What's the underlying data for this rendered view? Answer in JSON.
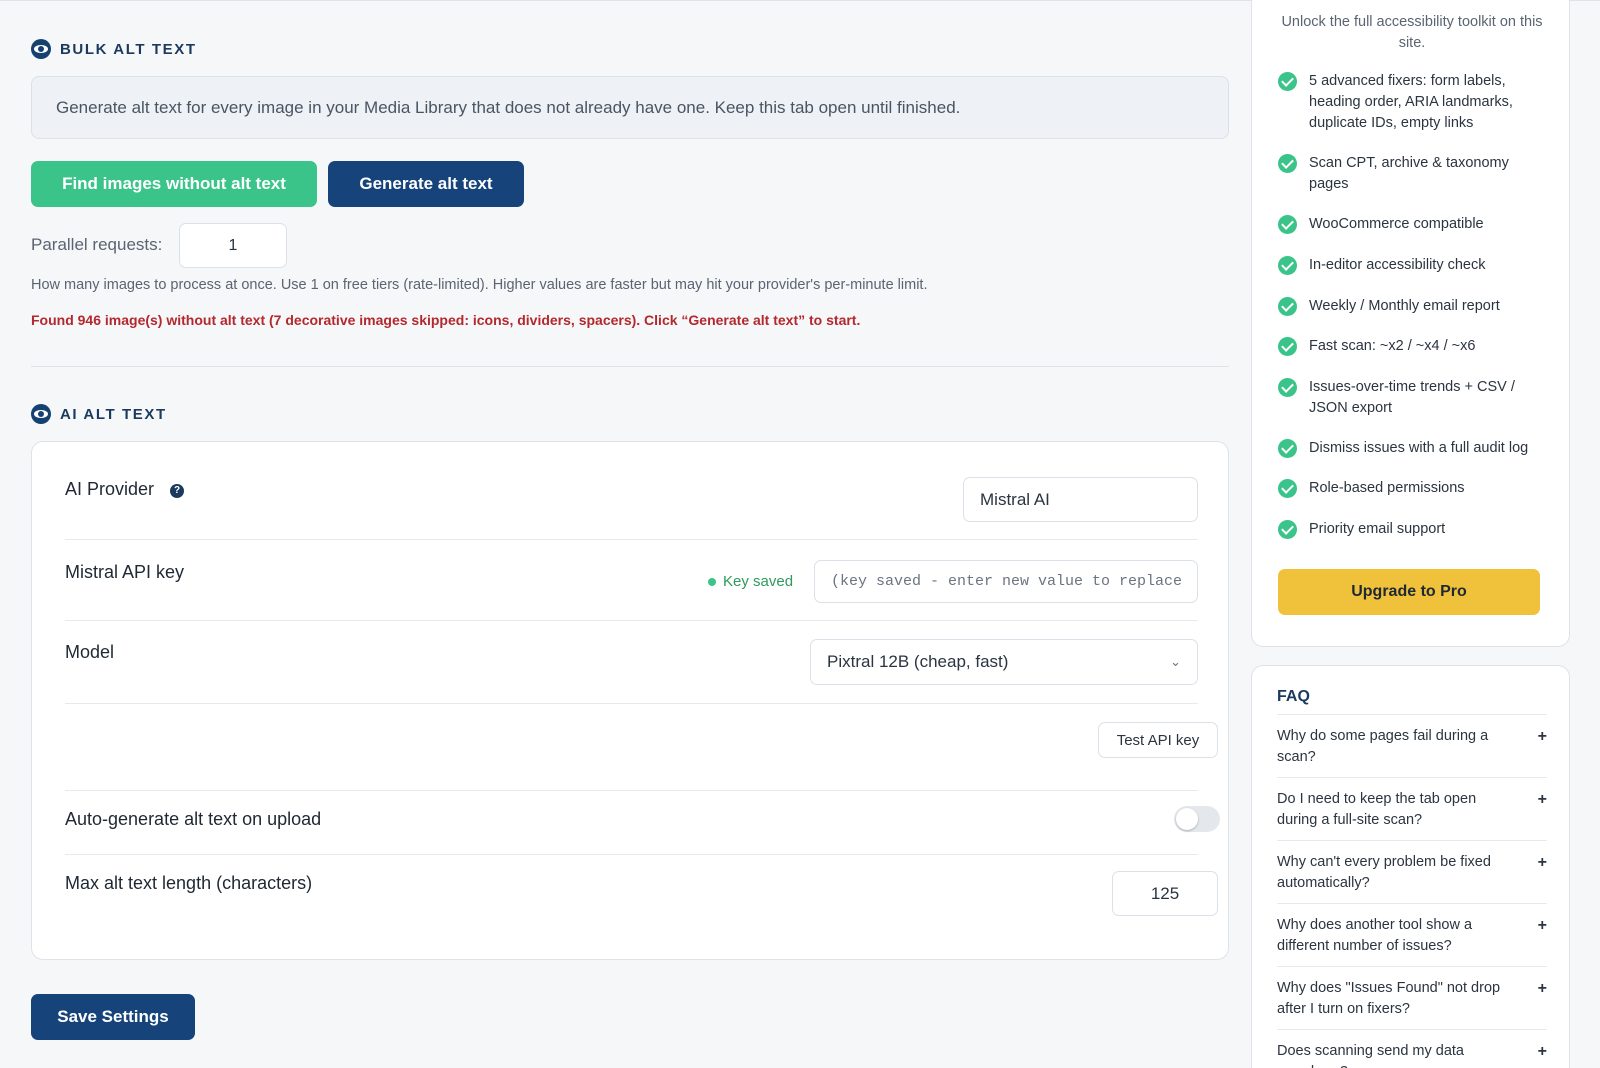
{
  "bulk": {
    "heading": "BULK ALT TEXT",
    "info": "Generate alt text for every image in your Media Library that does not already have one. Keep this tab open until finished.",
    "find_button": "Find images without alt text",
    "generate_button": "Generate alt text",
    "parallel_label": "Parallel requests:",
    "parallel_value": "1",
    "help": "How many images to process at once. Use 1 on free tiers (rate-limited). Higher values are faster but may hit your provider's per-minute limit.",
    "found": "Found 946 image(s) without alt text (7 decorative images skipped: icons, dividers, spacers). Click “Generate alt text” to start."
  },
  "ai": {
    "heading": "AI ALT TEXT",
    "provider_label": "AI Provider",
    "help_icon": "?",
    "provider_value": "Mistral AI",
    "key_label": "Mistral API key",
    "key_status": "Key saved",
    "key_placeholder": "(key saved - enter new value to replace)",
    "model_label": "Model",
    "model_value": "Pixtral 12B (cheap, fast)",
    "test_button": "Test API key",
    "auto_label": "Auto-generate alt text on upload",
    "auto_enabled": false,
    "max_label": "Max alt text length (characters)",
    "max_value": "125",
    "save_button": "Save Settings"
  },
  "pro": {
    "intro": "Unlock the full accessibility toolkit on this site.",
    "features": [
      "5 advanced fixers: form labels, heading order, ARIA landmarks, duplicate IDs, empty links",
      "Scan CPT, archive & taxonomy pages",
      "WooCommerce compatible",
      "In-editor accessibility check",
      "Weekly / Monthly email report",
      "Fast scan: ~x2 / ~x4 / ~x6",
      "Issues-over-time trends + CSV / JSON export",
      "Dismiss issues with a full audit log",
      "Role-based permissions",
      "Priority email support"
    ],
    "upgrade_button": "Upgrade to Pro"
  },
  "faq": {
    "title": "FAQ",
    "items": [
      "Why do some pages fail during a scan?",
      "Do I need to keep the tab open during a full-site scan?",
      "Why can't every problem be fixed automatically?",
      "Why does another tool show a different number of issues?",
      "Why does \"Issues Found\" not drop after I turn on fixers?",
      "Does scanning send my data anywhere?"
    ]
  },
  "colors": {
    "accent_navy": "#16437a",
    "accent_green": "#3bc48a",
    "upgrade_yellow": "#f0c23c",
    "error_red": "#b3282d"
  }
}
